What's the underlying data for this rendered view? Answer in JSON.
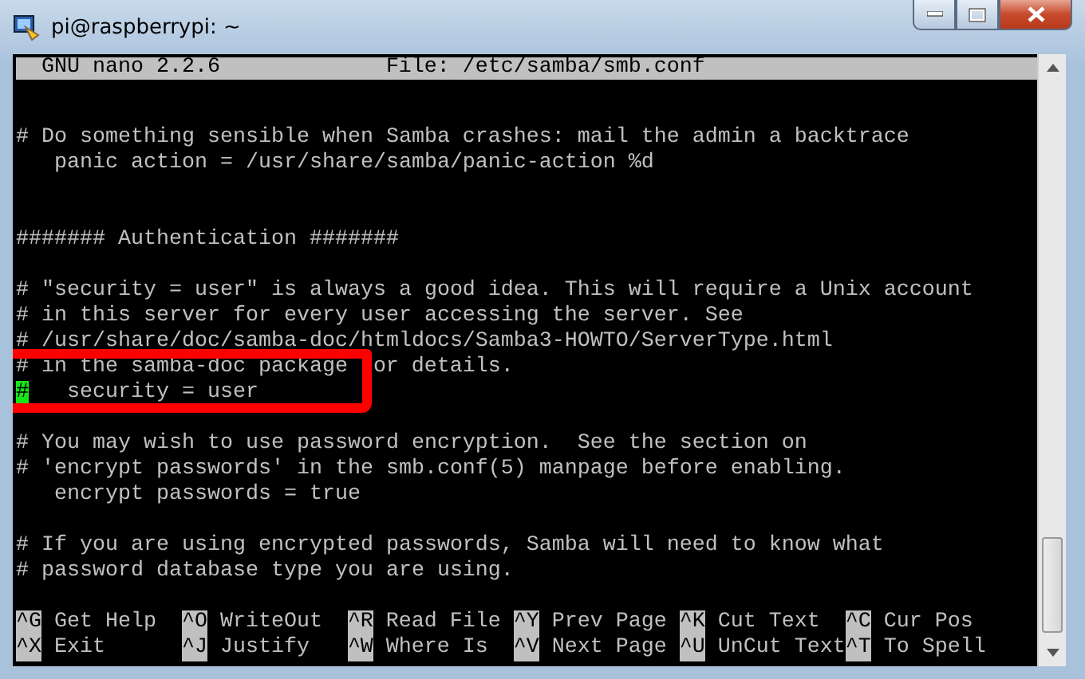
{
  "window": {
    "title": "pi@raspberrypi: ~"
  },
  "nano_header": {
    "version": "GNU nano 2.2.6",
    "file": "File: /etc/samba/smb.conf"
  },
  "lines": [
    {
      "kind": "text",
      "text": "# Do something sensible when Samba crashes: mail the admin a backtrace",
      "cursor": false
    },
    {
      "kind": "text",
      "text": "   panic action = /usr/share/samba/panic-action %d",
      "cursor": false
    },
    {
      "kind": "blank",
      "cursor": false
    },
    {
      "kind": "blank",
      "cursor": false
    },
    {
      "kind": "text",
      "text": "####### Authentication #######",
      "cursor": false
    },
    {
      "kind": "blank",
      "cursor": false
    },
    {
      "kind": "text",
      "text": "# \"security = user\" is always a good idea. This will require a Unix account",
      "cursor": false
    },
    {
      "kind": "text",
      "text": "# in this server for every user accessing the server. See",
      "cursor": false
    },
    {
      "kind": "text",
      "text": "# /usr/share/doc/samba-doc/htmldocs/Samba3-HOWTO/ServerType.html",
      "cursor": false
    },
    {
      "kind": "split",
      "segments": [
        "# in the samba-doc package",
        "or details."
      ],
      "cursor": false
    },
    {
      "kind": "text",
      "text": "#   security = user",
      "cursor": true
    },
    {
      "kind": "blank",
      "cursor": false
    },
    {
      "kind": "text",
      "text": "# You may wish to use password encryption.  See the section on",
      "cursor": false
    },
    {
      "kind": "text",
      "text": "# 'encrypt passwords' in the smb.conf(5) manpage before enabling.",
      "cursor": false
    },
    {
      "kind": "text",
      "text": "   encrypt passwords = true",
      "cursor": false
    },
    {
      "kind": "blank",
      "cursor": false
    },
    {
      "kind": "text",
      "text": "# If you are using encrypted passwords, Samba will need to know what",
      "cursor": false
    },
    {
      "kind": "text",
      "text": "# password database type you are using.",
      "cursor": false
    }
  ],
  "shortcuts": [
    [
      {
        "key": "^G",
        "label": "Get Help"
      },
      {
        "key": "^O",
        "label": "WriteOut"
      },
      {
        "key": "^R",
        "label": "Read File"
      },
      {
        "key": "^Y",
        "label": "Prev Page"
      },
      {
        "key": "^K",
        "label": "Cut Text"
      },
      {
        "key": "^C",
        "label": "Cur Pos"
      }
    ],
    [
      {
        "key": "^X",
        "label": "Exit"
      },
      {
        "key": "^J",
        "label": "Justify"
      },
      {
        "key": "^W",
        "label": "Where Is"
      },
      {
        "key": "^V",
        "label": "Next Page"
      },
      {
        "key": "^U",
        "label": "UnCut Text"
      },
      {
        "key": "^T",
        "label": "To Spell"
      }
    ]
  ]
}
